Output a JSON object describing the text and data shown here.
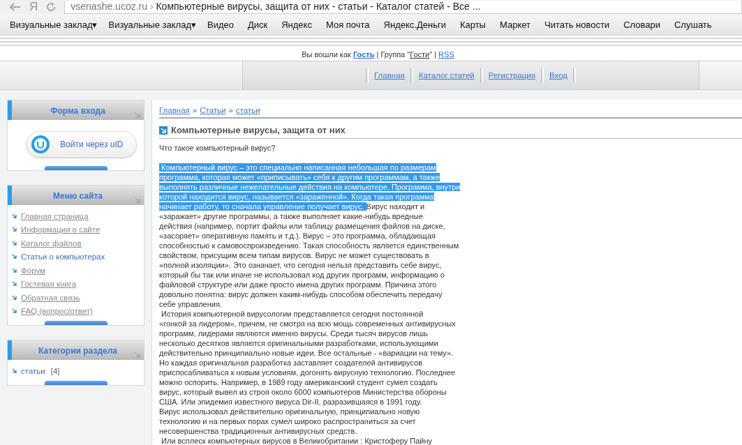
{
  "browser": {
    "logo": "Я",
    "address": "vsenashe.ucoz.ru",
    "separator": "›",
    "page_title": "Компьютерные вирусы, защита от них - статьи - Каталог статей - Все ...",
    "bookmarks": [
      {
        "label": "Визуальные заклад",
        "dropdown": true
      },
      {
        "label": "Визуальные заклад",
        "dropdown": true
      },
      {
        "label": "Видео",
        "dropdown": false
      },
      {
        "label": "Диск",
        "dropdown": false
      },
      {
        "label": "Яндекс",
        "dropdown": false
      },
      {
        "label": "Моя почта",
        "dropdown": false
      },
      {
        "label": "Яндекс.Деньги",
        "dropdown": false
      },
      {
        "label": "Карты",
        "dropdown": false
      },
      {
        "label": "Маркет",
        "dropdown": false
      },
      {
        "label": "Читать новости",
        "dropdown": false
      },
      {
        "label": "Словари",
        "dropdown": false
      },
      {
        "label": "Слушать",
        "dropdown": false
      }
    ],
    "dropdown_glyph": "▾"
  },
  "user_bar": {
    "prefix": "Вы вошли как",
    "user": "Гость",
    "separator1": "| Группа \"",
    "group": "Гости",
    "separator2": "\" |",
    "rss": "RSS"
  },
  "nav": [
    {
      "label": "Главная"
    },
    {
      "label": "Каталог статей"
    },
    {
      "label": "Регистрация"
    },
    {
      "label": "Вход"
    }
  ],
  "sidebar": [
    {
      "kind": "login",
      "title": "Форма входа",
      "button": "Войти через uID"
    },
    {
      "kind": "links",
      "title": "Меню сайта",
      "items": [
        {
          "label": "Главная страница",
          "selected": false
        },
        {
          "label": "Информация о сайте",
          "selected": false
        },
        {
          "label": "Каталог файлов",
          "selected": false
        },
        {
          "label": "Статьи о компьютерах",
          "selected": true
        },
        {
          "label": "Форум",
          "selected": false
        },
        {
          "label": "Гостевая книга",
          "selected": false
        },
        {
          "label": "Обратная связь",
          "selected": false
        },
        {
          "label": "FAQ (вопрос/ответ)",
          "selected": false
        }
      ]
    },
    {
      "kind": "categories",
      "title": "Категории раздела",
      "items": [
        {
          "label": "статьи",
          "count": "[4]"
        }
      ]
    }
  ],
  "breadcrumb": [
    {
      "label": "Главная"
    },
    {
      "label": "Статьи"
    },
    {
      "label": "статьи"
    }
  ],
  "breadcrumb_separator": "»",
  "article": {
    "title": "Компьютерные вирусы, защита от них",
    "intro": "Что такое компьютерный вирус?",
    "paragraphs": [
      [
        [
          {
            "text": " Компьютерный вирус – это специально написанная небольшая по размерам",
            "selected": true
          }
        ],
        [
          {
            "text": "программа, которая может «приписывать» себя к другим программам, а также",
            "selected": true
          }
        ],
        [
          {
            "text": "выполнять различные нежелательные действия на компьютере. Программа, внутри",
            "selected": true
          }
        ],
        [
          {
            "text": "которой находится вирус, называется «зараженной». Когда такая программа",
            "selected": true
          }
        ],
        [
          {
            "text": "начинает работу, то сначала управление получает вирус. ",
            "selected": true
          },
          {
            "text": "Вирус находит и",
            "selected": false
          }
        ],
        [
          {
            "text": "«заражает» другие программы, а также выполняет какие-нибудь вредные",
            "selected": false
          }
        ],
        [
          {
            "text": "действия (например, портит файлы или таблицу размещения файлов на диске,",
            "selected": false
          }
        ],
        [
          {
            "text": "«засоряет» оперативную память и т.д.). Вирус – это программа, обладающая",
            "selected": false
          }
        ],
        [
          {
            "text": "способностью к самовоспроизведению. Такая способность является единственным",
            "selected": false
          }
        ],
        [
          {
            "text": "свойством, присущим всем типам вирусов. Вирус не может существовать в",
            "selected": false
          }
        ],
        [
          {
            "text": "«полной изоляции». Это означает, что сегодня нельзя представить себе вирус,",
            "selected": false
          }
        ],
        [
          {
            "text": "который бы так или иначе не использовал код других программ, информацию о",
            "selected": false
          }
        ],
        [
          {
            "text": "файловой структуре или даже просто имена других программ. Причина этого",
            "selected": false
          }
        ],
        [
          {
            "text": "довольно понятна: вирус должен каким-нибудь способом обеспечить передачу",
            "selected": false
          }
        ],
        [
          {
            "text": "себе управления.",
            "selected": false
          }
        ]
      ],
      [
        [
          {
            "text": " История компьютерной вирусологии представляется сегодня постоянной",
            "selected": false
          }
        ],
        [
          {
            "text": "«гонкой за лидером», причем, не смотря на всю мощь современных антивирусных",
            "selected": false
          }
        ],
        [
          {
            "text": "программ, лидерами являются именно вирусы. Среди тысяч вирусов лишь",
            "selected": false
          }
        ],
        [
          {
            "text": "несколько десятков являются оригинальными разработками, использующими",
            "selected": false
          }
        ],
        [
          {
            "text": "действительно принципиально новые идеи. Все остальные - «вариации на тему».",
            "selected": false
          }
        ],
        [
          {
            "text": "Но каждая оригинальная разработка заставляет создателей антивирусов",
            "selected": false
          }
        ],
        [
          {
            "text": "приспосабливаться к новым условиям, догонять вирусную технологию. Последнее",
            "selected": false
          }
        ],
        [
          {
            "text": "можно оспорить. Например, в 1989 году американский студент сумел создать",
            "selected": false
          }
        ],
        [
          {
            "text": "вирус, который вывел из строя около 6000 компьютеров Министерства обороны",
            "selected": false
          }
        ],
        [
          {
            "text": "США. Или эпидемия известного вируса Dir-II, разразившаяся в 1991 году.",
            "selected": false
          }
        ],
        [
          {
            "text": "Вирус использовал действительно оригинальную, принципиально новую",
            "selected": false
          }
        ],
        [
          {
            "text": "технологию и на первых порах сумел широко распространиться за счет",
            "selected": false
          }
        ],
        [
          {
            "text": "несовершенства традиционных антивирусных средств.",
            "selected": false
          }
        ],
        [
          {
            "text": " Или всплеск компьютерных вирусов в Великобритании : Кристоферу Пайну",
            "selected": false
          }
        ]
      ]
    ]
  }
}
